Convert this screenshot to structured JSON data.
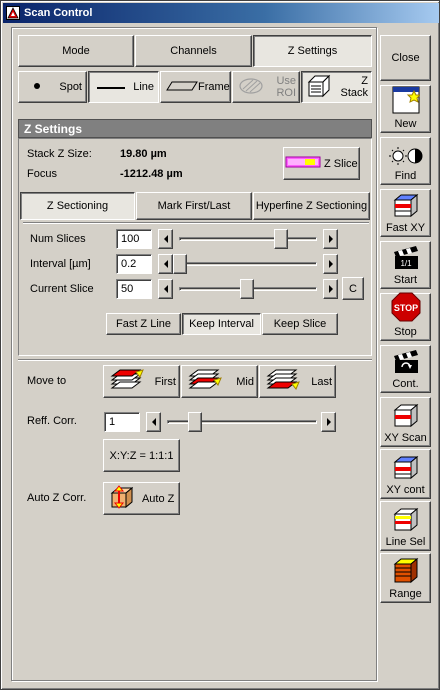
{
  "window": {
    "title": "Scan Control"
  },
  "tabs": [
    {
      "label": "Mode",
      "active": false
    },
    {
      "label": "Channels",
      "active": false
    },
    {
      "label": "Z Settings",
      "active": true
    }
  ],
  "scan_modes": {
    "spot": "Spot",
    "line": "Line",
    "frame": "Frame",
    "use_roi": "Use ROI",
    "z_stack": "Z Stack"
  },
  "z_settings": {
    "header": "Z Settings",
    "stack_size_label": "Stack Z Size:",
    "stack_size_value": "19.80 µm",
    "focus_label": "Focus",
    "focus_value": "-1212.48 µm",
    "z_slice_button": "Z Slice",
    "subtabs": [
      {
        "label": "Z Sectioning",
        "active": true
      },
      {
        "label": "Mark First/Last",
        "active": false
      },
      {
        "label": "Hyperfine Z Sectioning",
        "active": false
      }
    ],
    "num_slices_label": "Num Slices",
    "num_slices_value": "100",
    "num_slices_position": 0.75,
    "interval_label": "Interval [µm]",
    "interval_value": "0.2",
    "interval_position": 0.0,
    "current_slice_label": "Current Slice",
    "current_slice_value": "50",
    "current_slice_position": 0.5,
    "c_button": "C",
    "fast_z_line": "Fast Z Line",
    "keep_interval": "Keep Interval",
    "keep_slice": "Keep Slice"
  },
  "lower": {
    "move_to_label": "Move to",
    "first": "First",
    "mid": "Mid",
    "last": "Last",
    "reff_corr_label": "Reff. Corr.",
    "reff_corr_value": "1",
    "reff_corr_position": 0.15,
    "xyz_button": "X:Y:Z = 1:1:1",
    "auto_z_corr_label": "Auto Z Corr.",
    "auto_z_button": "Auto Z"
  },
  "sidebar": {
    "close": "Close",
    "new": "New",
    "find": "Find",
    "fast_xy": "Fast XY",
    "start": "Start",
    "stop": "Stop",
    "stop_sign": "STOP",
    "cont": "Cont.",
    "xy_scan": "XY Scan",
    "xy_cont": "XY cont",
    "line_sel": "Line Sel",
    "range": "Range",
    "start_clapper": "1/1"
  },
  "colors": {
    "title_bar": "#0a246a",
    "section_header": "#808080",
    "stop_red": "#cc0000",
    "face": "#d4d0c8"
  }
}
